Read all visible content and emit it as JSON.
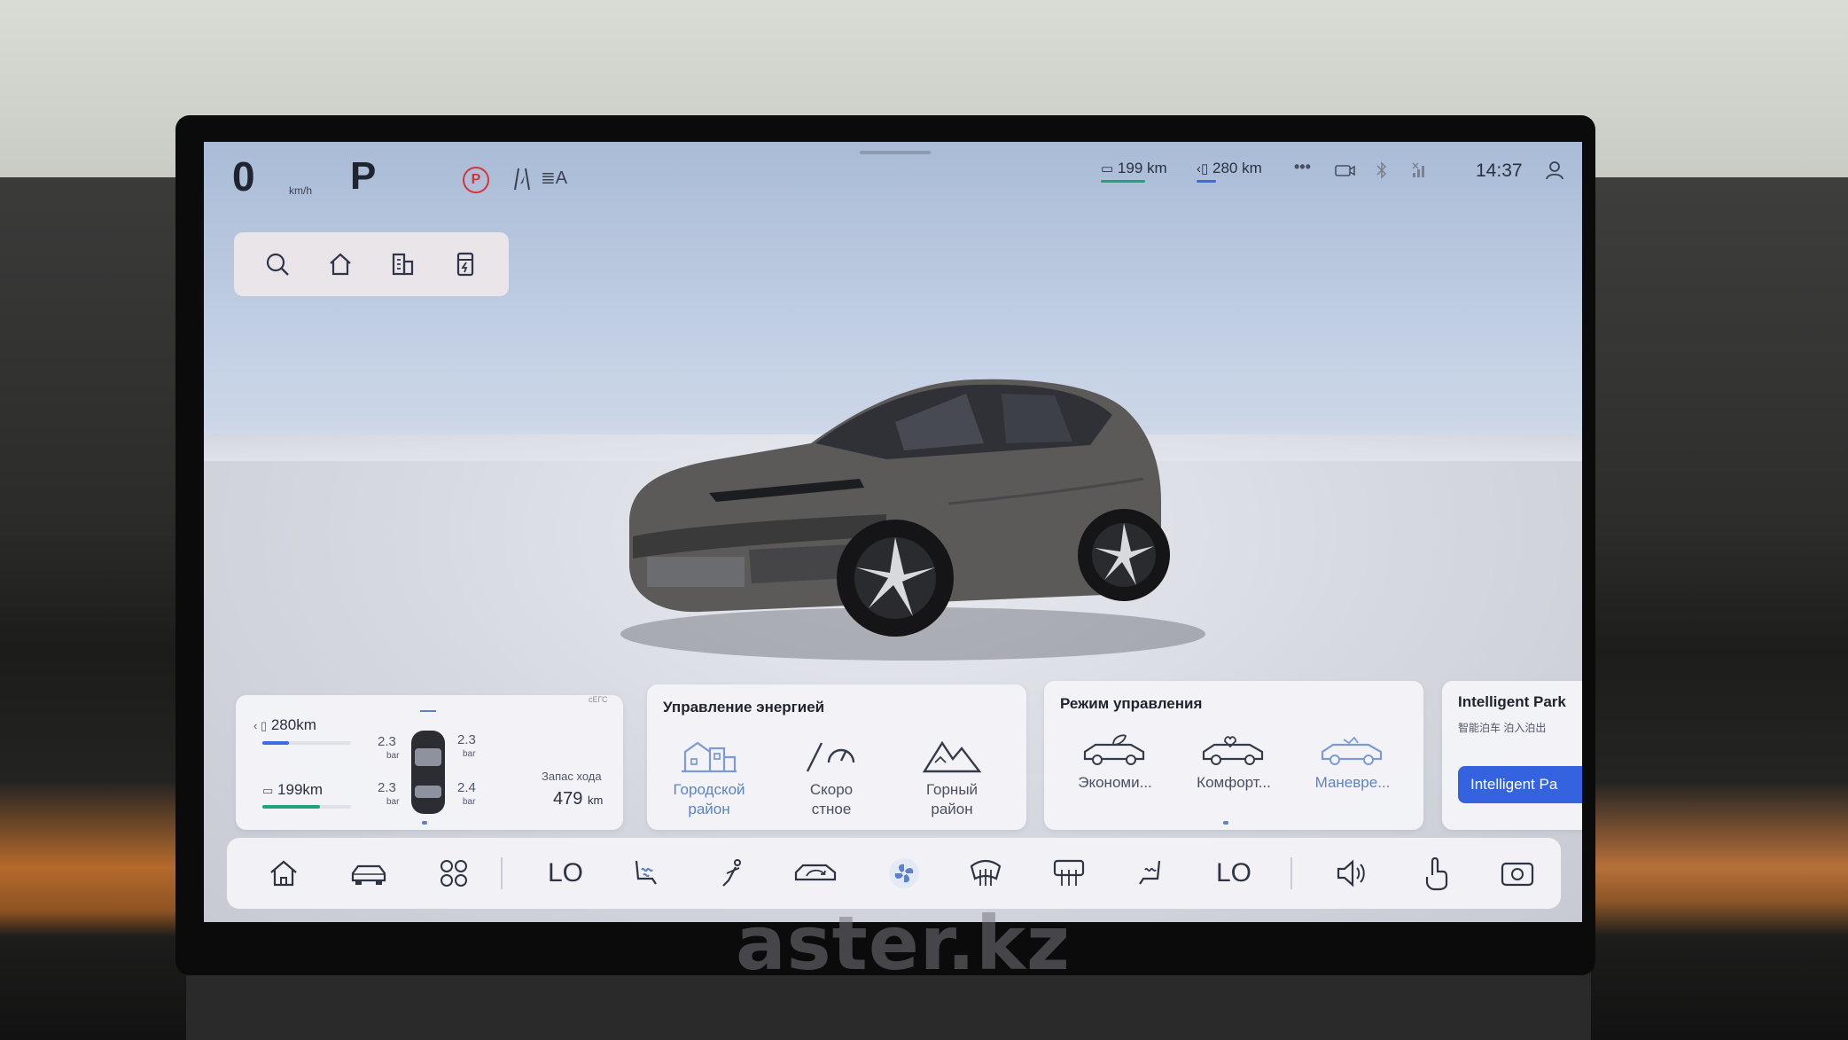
{
  "status_bar": {
    "speed": "0",
    "speed_unit": "km/h",
    "gear": "P",
    "parking_brake_symbol": "P",
    "beam_symbol": "≣A",
    "electric_range": "199 km",
    "fuel_range": "280 km",
    "more": "•••",
    "clock": "14:37",
    "icons": [
      "parking-brake-icon",
      "lane-assist-icon",
      "auto-headlight-icon",
      "electric-range-icon",
      "fuel-range-icon",
      "more-icon",
      "camera-icon",
      "bluetooth-icon",
      "signal-icon",
      "user-icon"
    ],
    "colors": {
      "electric": "#1fa37a",
      "fuel": "#3d6be0",
      "parking_brake": "#d6333a"
    }
  },
  "quick_nav": {
    "icons": [
      "search-icon",
      "home-icon",
      "company-icon",
      "charging-station-icon"
    ]
  },
  "tpms_card": {
    "fuel_range": "280km",
    "electric_range": "199km",
    "fuel_level": 0.3,
    "battery_level": 0.65,
    "tire_front_left": "2.3",
    "tire_front_right": "2.3",
    "tire_rear_left": "2.3",
    "tire_rear_right": "2.4",
    "tire_unit": "bar",
    "range_label": "Запас хода",
    "range_value": "479",
    "range_unit": "km",
    "corner_text": "сЕГС"
  },
  "energy_card": {
    "title": "Управление энергией",
    "modes": [
      {
        "label_line1": "Городской",
        "label_line2": "район",
        "icon": "city-icon",
        "active": true
      },
      {
        "label_line1": "Скоро",
        "label_line2": "стное",
        "icon": "speedometer-icon",
        "active": false
      },
      {
        "label_line1": "Горный",
        "label_line2": "район",
        "icon": "mountain-icon",
        "active": false
      }
    ]
  },
  "drive_card": {
    "title": "Режим управления",
    "modes": [
      {
        "label": "Экономи...",
        "icon": "eco-car-icon",
        "active": false
      },
      {
        "label": "Комфорт...",
        "icon": "comfort-car-icon",
        "active": false
      },
      {
        "label": "Маневре...",
        "icon": "sport-car-icon",
        "active": true
      }
    ]
  },
  "park_card": {
    "title": "Intelligent Park",
    "subtitle": "智能泊车 泊入泊出",
    "button": "Intelligent Pa"
  },
  "dock": {
    "temp_left": "LO",
    "temp_right": "LO",
    "icons": [
      "home-icon",
      "car-icon",
      "apps-icon",
      "seat-heat-icon",
      "seat-belt-icon",
      "recirculation-icon",
      "fan-icon",
      "windshield-defrost-icon",
      "rear-defrost-icon",
      "passenger-seat-icon",
      "volume-icon",
      "gesture-icon",
      "camera-icon"
    ],
    "colors": {
      "fan_active": "#5b82c8"
    }
  },
  "watermark": "aster.kz"
}
